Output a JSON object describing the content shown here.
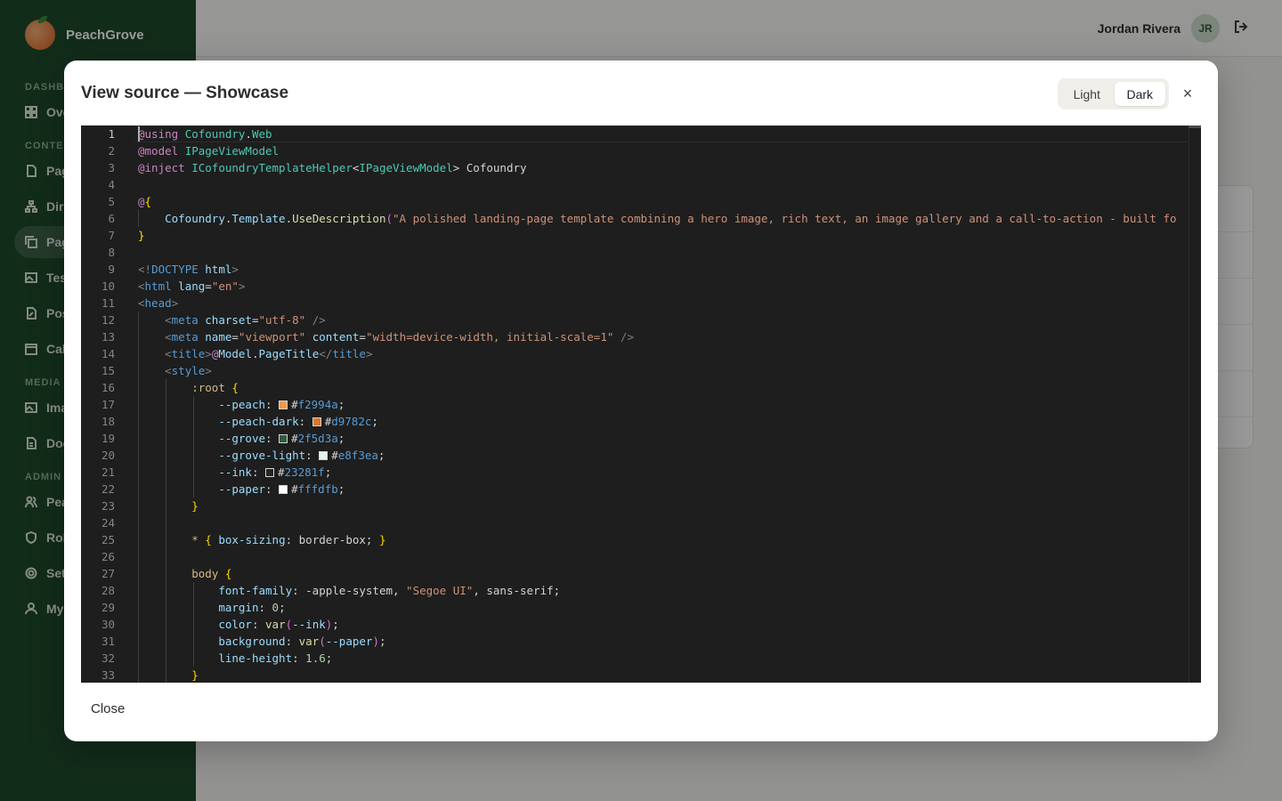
{
  "app": {
    "brand": "PeachGrove",
    "sidebar": {
      "sections": [
        {
          "label": "DASHBOARD"
        },
        {
          "label": "CONTENT"
        },
        {
          "label": "MEDIA"
        },
        {
          "label": "ADMIN"
        }
      ],
      "items": [
        {
          "label": "Overview",
          "icon": "grid-icon"
        },
        {
          "label": "Pages",
          "icon": "file-icon"
        },
        {
          "label": "Directories",
          "icon": "sitemap-icon"
        },
        {
          "label": "Page Templates",
          "icon": "copy-icon",
          "active": true
        },
        {
          "label": "Testimonials",
          "icon": "image-icon"
        },
        {
          "label": "Posts",
          "icon": "file-edit-icon"
        },
        {
          "label": "Calendar",
          "icon": "calendar-icon"
        },
        {
          "label": "Images",
          "icon": "image-icon"
        },
        {
          "label": "Documents",
          "icon": "document-icon"
        },
        {
          "label": "PeachGrove Users",
          "icon": "users-icon"
        },
        {
          "label": "Roles",
          "icon": "shield-icon"
        },
        {
          "label": "Settings",
          "icon": "gear-icon"
        },
        {
          "label": "My Account",
          "icon": "user-icon"
        }
      ]
    },
    "topbar": {
      "user_name": "Jordan Rivera",
      "avatar_initials": "JR",
      "logout_icon": "logout-icon"
    }
  },
  "modal": {
    "title": "View source — Showcase",
    "theme_options": [
      "Light",
      "Dark"
    ],
    "theme_selected": "Dark",
    "close_x": "×",
    "footer_close": "Close",
    "editor": {
      "current_line": 1,
      "line_numbers": [
        "1",
        "2",
        "3",
        "4",
        "5",
        "6",
        "7",
        "8",
        "9",
        "10",
        "11",
        "12",
        "13",
        "14",
        "15",
        "16",
        "17",
        "18",
        "19",
        "20",
        "21",
        "22",
        "23",
        "24",
        "25",
        "26",
        "27",
        "28",
        "29",
        "30",
        "31",
        "32",
        "33"
      ],
      "lines": [
        [
          [
            "at",
            "@using"
          ],
          [
            "plain",
            " "
          ],
          [
            "type",
            "Cofoundry"
          ],
          [
            "plain",
            "."
          ],
          [
            "type",
            "Web"
          ]
        ],
        [
          [
            "at",
            "@model"
          ],
          [
            "plain",
            " "
          ],
          [
            "type",
            "IPageViewModel"
          ]
        ],
        [
          [
            "at",
            "@inject"
          ],
          [
            "plain",
            " "
          ],
          [
            "type",
            "ICofoundryTemplateHelper"
          ],
          [
            "plain",
            "<"
          ],
          [
            "type",
            "IPageViewModel"
          ],
          [
            "plain",
            "> Cofoundry"
          ]
        ],
        [],
        [
          [
            "at",
            "@"
          ],
          [
            "br",
            "{"
          ]
        ],
        [
          [
            "plain",
            "    "
          ],
          [
            "prop",
            "Cofoundry"
          ],
          [
            "plain",
            "."
          ],
          [
            "prop",
            "Template"
          ],
          [
            "plain",
            "."
          ],
          [
            "method",
            "UseDescription"
          ],
          [
            "par",
            "("
          ],
          [
            "str",
            "\"A polished landing-page template combining a hero image, rich text, an image gallery and a call-to-action - built fo"
          ]
        ],
        [
          [
            "br",
            "}"
          ]
        ],
        [],
        [
          [
            "tag",
            "<!"
          ],
          [
            "tagname",
            "DOCTYPE"
          ],
          [
            "plain",
            " "
          ],
          [
            "attr",
            "html"
          ],
          [
            "tag",
            ">"
          ]
        ],
        [
          [
            "tag",
            "<"
          ],
          [
            "tagname",
            "html"
          ],
          [
            "plain",
            " "
          ],
          [
            "attr",
            "lang"
          ],
          [
            "plain",
            "="
          ],
          [
            "str",
            "\"en\""
          ],
          [
            "tag",
            ">"
          ]
        ],
        [
          [
            "tag",
            "<"
          ],
          [
            "tagname",
            "head"
          ],
          [
            "tag",
            ">"
          ]
        ],
        [
          [
            "plain",
            "    "
          ],
          [
            "tag",
            "<"
          ],
          [
            "tagname",
            "meta"
          ],
          [
            "plain",
            " "
          ],
          [
            "attr",
            "charset"
          ],
          [
            "plain",
            "="
          ],
          [
            "str",
            "\"utf-8\""
          ],
          [
            "plain",
            " "
          ],
          [
            "tag",
            "/>"
          ]
        ],
        [
          [
            "plain",
            "    "
          ],
          [
            "tag",
            "<"
          ],
          [
            "tagname",
            "meta"
          ],
          [
            "plain",
            " "
          ],
          [
            "attr",
            "name"
          ],
          [
            "plain",
            "="
          ],
          [
            "str",
            "\"viewport\""
          ],
          [
            "plain",
            " "
          ],
          [
            "attr",
            "content"
          ],
          [
            "plain",
            "="
          ],
          [
            "str",
            "\"width=device-width, initial-scale=1\""
          ],
          [
            "plain",
            " "
          ],
          [
            "tag",
            "/>"
          ]
        ],
        [
          [
            "plain",
            "    "
          ],
          [
            "tag",
            "<"
          ],
          [
            "tagname",
            "title"
          ],
          [
            "tag",
            ">"
          ],
          [
            "at",
            "@"
          ],
          [
            "prop",
            "Model"
          ],
          [
            "plain",
            "."
          ],
          [
            "prop",
            "PageTitle"
          ],
          [
            "tag",
            "</"
          ],
          [
            "tagname",
            "title"
          ],
          [
            "tag",
            ">"
          ]
        ],
        [
          [
            "plain",
            "    "
          ],
          [
            "tag",
            "<"
          ],
          [
            "tagname",
            "style"
          ],
          [
            "tag",
            ">"
          ]
        ],
        [
          [
            "plain",
            "        "
          ],
          [
            "sel",
            ":root"
          ],
          [
            "plain",
            " "
          ],
          [
            "br",
            "{"
          ]
        ],
        [
          [
            "plain",
            "            "
          ],
          [
            "prop",
            "--peach"
          ],
          [
            "plain",
            ": "
          ],
          [
            "swatch",
            "#f2994a"
          ],
          [
            "plain",
            "#"
          ],
          [
            "hex",
            "f2994a"
          ],
          [
            "plain",
            ";"
          ]
        ],
        [
          [
            "plain",
            "            "
          ],
          [
            "prop",
            "--peach-dark"
          ],
          [
            "plain",
            ": "
          ],
          [
            "swatch",
            "#d9782c"
          ],
          [
            "plain",
            "#"
          ],
          [
            "hex",
            "d9782c"
          ],
          [
            "plain",
            ";"
          ]
        ],
        [
          [
            "plain",
            "            "
          ],
          [
            "prop",
            "--grove"
          ],
          [
            "plain",
            ": "
          ],
          [
            "swatch",
            "#2f5d3a"
          ],
          [
            "plain",
            "#"
          ],
          [
            "hex",
            "2f5d3a"
          ],
          [
            "plain",
            ";"
          ]
        ],
        [
          [
            "plain",
            "            "
          ],
          [
            "prop",
            "--grove-light"
          ],
          [
            "plain",
            ": "
          ],
          [
            "swatch",
            "#e8f3ea"
          ],
          [
            "plain",
            "#"
          ],
          [
            "hex",
            "e8f3ea"
          ],
          [
            "plain",
            ";"
          ]
        ],
        [
          [
            "plain",
            "            "
          ],
          [
            "prop",
            "--ink"
          ],
          [
            "plain",
            ": "
          ],
          [
            "swatch",
            "#23281f"
          ],
          [
            "plain",
            "#"
          ],
          [
            "hex",
            "23281f"
          ],
          [
            "plain",
            ";"
          ]
        ],
        [
          [
            "plain",
            "            "
          ],
          [
            "prop",
            "--paper"
          ],
          [
            "plain",
            ": "
          ],
          [
            "swatch",
            "#fffdfb"
          ],
          [
            "plain",
            "#"
          ],
          [
            "hex",
            "fffdfb"
          ],
          [
            "plain",
            ";"
          ]
        ],
        [
          [
            "plain",
            "        "
          ],
          [
            "br",
            "}"
          ]
        ],
        [],
        [
          [
            "plain",
            "        "
          ],
          [
            "sel",
            "*"
          ],
          [
            "plain",
            " "
          ],
          [
            "br",
            "{"
          ],
          [
            "plain",
            " "
          ],
          [
            "prop",
            "box-sizing"
          ],
          [
            "plain",
            ": border-box; "
          ],
          [
            "br",
            "}"
          ]
        ],
        [],
        [
          [
            "plain",
            "        "
          ],
          [
            "sel",
            "body"
          ],
          [
            "plain",
            " "
          ],
          [
            "br",
            "{"
          ]
        ],
        [
          [
            "plain",
            "            "
          ],
          [
            "prop",
            "font-family"
          ],
          [
            "plain",
            ": -apple-system, "
          ],
          [
            "str",
            "\"Segoe UI\""
          ],
          [
            "plain",
            ", sans-serif;"
          ]
        ],
        [
          [
            "plain",
            "            "
          ],
          [
            "prop",
            "margin"
          ],
          [
            "plain",
            ": "
          ],
          [
            "num",
            "0"
          ],
          [
            "plain",
            ";"
          ]
        ],
        [
          [
            "plain",
            "            "
          ],
          [
            "prop",
            "color"
          ],
          [
            "plain",
            ": "
          ],
          [
            "method",
            "var"
          ],
          [
            "par",
            "("
          ],
          [
            "prop",
            "--ink"
          ],
          [
            "par",
            ")"
          ],
          [
            "plain",
            ";"
          ]
        ],
        [
          [
            "plain",
            "            "
          ],
          [
            "prop",
            "background"
          ],
          [
            "plain",
            ": "
          ],
          [
            "method",
            "var"
          ],
          [
            "par",
            "("
          ],
          [
            "prop",
            "--paper"
          ],
          [
            "par",
            ")"
          ],
          [
            "plain",
            ";"
          ]
        ],
        [
          [
            "plain",
            "            "
          ],
          [
            "prop",
            "line-height"
          ],
          [
            "plain",
            ": "
          ],
          [
            "num",
            "1.6"
          ],
          [
            "plain",
            ";"
          ]
        ],
        [
          [
            "plain",
            "        "
          ],
          [
            "br",
            "}"
          ]
        ]
      ]
    }
  }
}
